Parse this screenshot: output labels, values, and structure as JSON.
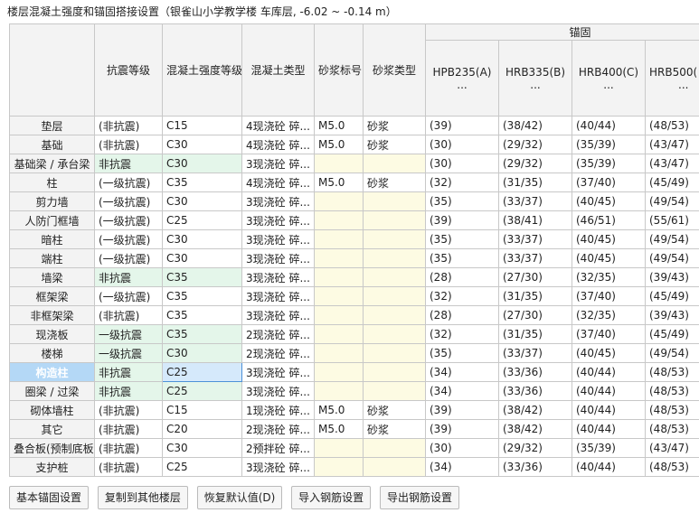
{
  "window": {
    "title": "楼层混凝土强度和锚固搭接设置（银雀山小学教学楼   车库层, -6.02 ~ -0.14 m）"
  },
  "table": {
    "group_label": "锚固",
    "headers": {
      "seismic": "抗震等级",
      "concrete_grade": "混凝土强度等级",
      "concrete_type": "混凝土类型",
      "mortar_grade": "砂浆标号",
      "mortar_type": "砂浆类型",
      "hpb235": "HPB235(A)",
      "hrb335": "HRB335(B)",
      "hrb400": "HRB400(C)",
      "hrb500": "HRB500(",
      "ellipsis": "..."
    },
    "rows": [
      {
        "name": "垫层",
        "seismic": "(非抗震)",
        "grade": "C15",
        "ctype": "4现浇砼 碎...",
        "mgrade": "M5.0",
        "mtype": "砂浆",
        "a": "(39)",
        "b": "(38/42)",
        "c": "(40/44)",
        "d": "(48/53)"
      },
      {
        "name": "基础",
        "seismic": "(非抗震)",
        "grade": "C30",
        "ctype": "4现浇砼 碎...",
        "mgrade": "M5.0",
        "mtype": "砂浆",
        "a": "(30)",
        "b": "(29/32)",
        "c": "(35/39)",
        "d": "(43/47)"
      },
      {
        "name": "基础梁 / 承台梁",
        "seismic": "非抗震",
        "grade": "C30",
        "ctype": "3现浇砼 碎...",
        "mgrade": "",
        "mtype": "",
        "a": "(30)",
        "b": "(29/32)",
        "c": "(35/39)",
        "d": "(43/47)"
      },
      {
        "name": "柱",
        "seismic": "(一级抗震)",
        "grade": "C35",
        "ctype": "4现浇砼 碎...",
        "mgrade": "M5.0",
        "mtype": "砂浆",
        "a": "(32)",
        "b": "(31/35)",
        "c": "(37/40)",
        "d": "(45/49)"
      },
      {
        "name": "剪力墙",
        "seismic": "(一级抗震)",
        "grade": "C30",
        "ctype": "3现浇砼 碎...",
        "mgrade": "",
        "mtype": "",
        "a": "(35)",
        "b": "(33/37)",
        "c": "(40/45)",
        "d": "(49/54)"
      },
      {
        "name": "人防门框墙",
        "seismic": "(一级抗震)",
        "grade": "C25",
        "ctype": "3现浇砼 碎...",
        "mgrade": "",
        "mtype": "",
        "a": "(39)",
        "b": "(38/41)",
        "c": "(46/51)",
        "d": "(55/61)"
      },
      {
        "name": "暗柱",
        "seismic": "(一级抗震)",
        "grade": "C30",
        "ctype": "3现浇砼 碎...",
        "mgrade": "",
        "mtype": "",
        "a": "(35)",
        "b": "(33/37)",
        "c": "(40/45)",
        "d": "(49/54)"
      },
      {
        "name": "端柱",
        "seismic": "(一级抗震)",
        "grade": "C30",
        "ctype": "3现浇砼 碎...",
        "mgrade": "",
        "mtype": "",
        "a": "(35)",
        "b": "(33/37)",
        "c": "(40/45)",
        "d": "(49/54)"
      },
      {
        "name": "墙梁",
        "seismic": "非抗震",
        "grade": "C35",
        "ctype": "3现浇砼 碎...",
        "mgrade": "",
        "mtype": "",
        "a": "(28)",
        "b": "(27/30)",
        "c": "(32/35)",
        "d": "(39/43)"
      },
      {
        "name": "框架梁",
        "seismic": "(一级抗震)",
        "grade": "C35",
        "ctype": "3现浇砼 碎...",
        "mgrade": "",
        "mtype": "",
        "a": "(32)",
        "b": "(31/35)",
        "c": "(37/40)",
        "d": "(45/49)"
      },
      {
        "name": "非框架梁",
        "seismic": "(非抗震)",
        "grade": "C35",
        "ctype": "3现浇砼 碎...",
        "mgrade": "",
        "mtype": "",
        "a": "(28)",
        "b": "(27/30)",
        "c": "(32/35)",
        "d": "(39/43)"
      },
      {
        "name": "现浇板",
        "seismic": "一级抗震",
        "grade": "C35",
        "ctype": "2现浇砼 碎...",
        "mgrade": "",
        "mtype": "",
        "a": "(32)",
        "b": "(31/35)",
        "c": "(37/40)",
        "d": "(45/49)"
      },
      {
        "name": "楼梯",
        "seismic": "一级抗震",
        "grade": "C30",
        "ctype": "2现浇砼 碎...",
        "mgrade": "",
        "mtype": "",
        "a": "(35)",
        "b": "(33/37)",
        "c": "(40/45)",
        "d": "(49/54)"
      },
      {
        "name": "构造柱",
        "seismic": "非抗震",
        "grade": "C25",
        "ctype": "3现浇砼 碎...",
        "mgrade": "",
        "mtype": "",
        "a": "(34)",
        "b": "(33/36)",
        "c": "(40/44)",
        "d": "(48/53)"
      },
      {
        "name": "圈梁 / 过梁",
        "seismic": "非抗震",
        "grade": "C25",
        "ctype": "3现浇砼 碎...",
        "mgrade": "",
        "mtype": "",
        "a": "(34)",
        "b": "(33/36)",
        "c": "(40/44)",
        "d": "(48/53)"
      },
      {
        "name": "砌体墙柱",
        "seismic": "(非抗震)",
        "grade": "C15",
        "ctype": "1现浇砼 碎...",
        "mgrade": "M5.0",
        "mtype": "砂浆",
        "a": "(39)",
        "b": "(38/42)",
        "c": "(40/44)",
        "d": "(48/53)"
      },
      {
        "name": "其它",
        "seismic": "(非抗震)",
        "grade": "C20",
        "ctype": "2现浇砼 碎...",
        "mgrade": "M5.0",
        "mtype": "砂浆",
        "a": "(39)",
        "b": "(38/42)",
        "c": "(40/44)",
        "d": "(48/53)"
      },
      {
        "name": "叠合板(预制底板)",
        "seismic": "(非抗震)",
        "grade": "C30",
        "ctype": "2预拌砼 碎...",
        "mgrade": "",
        "mtype": "",
        "a": "(30)",
        "b": "(29/32)",
        "c": "(35/39)",
        "d": "(43/47)"
      },
      {
        "name": "支护桩",
        "seismic": "(非抗震)",
        "grade": "C25",
        "ctype": "3现浇砼 碎...",
        "mgrade": "",
        "mtype": "",
        "a": "(34)",
        "b": "(33/36)",
        "c": "(40/44)",
        "d": "(48/53)"
      }
    ]
  },
  "buttons": {
    "basic": "基本锚固设置",
    "copy": "复制到其他楼层",
    "restore": "恢复默认值(D)",
    "import": "导入钢筋设置",
    "export": "导出钢筋设置"
  },
  "colors": {
    "active_header": "#b4d8f6",
    "seismic_cell": "#e4f6ea",
    "empty_mortar": "#fdfbe3",
    "selection_border": "#4d91d8"
  }
}
